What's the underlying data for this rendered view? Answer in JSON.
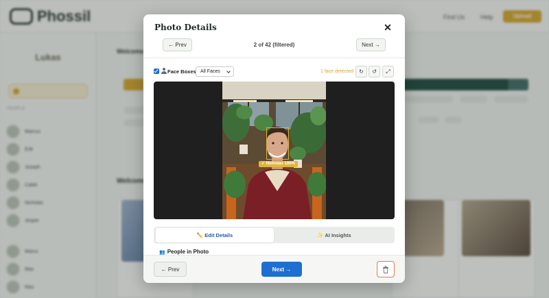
{
  "background": {
    "app_name": "Phossil",
    "top_links": [
      "Find Us",
      "Help"
    ],
    "upload_label": "Upload",
    "sidebar_user_name": "Lukas",
    "sidebar_section_label": "PEOPLE",
    "people": [
      {
        "name": "Marcus"
      },
      {
        "name": "Erik"
      },
      {
        "name": "Joseph"
      },
      {
        "name": "Caleb"
      },
      {
        "name": "Nicholas"
      },
      {
        "name": "Jesper"
      },
      {
        "name": "Marco"
      },
      {
        "name": "Max"
      },
      {
        "name": "Max"
      }
    ],
    "main_heading": "Welcome",
    "gallery_heading": "Welcome"
  },
  "modal": {
    "title": "Photo Details",
    "close_label": "✕",
    "prev_label": "← Prev",
    "next_label": "Next →",
    "counter": "2 of 42 (filtered)",
    "face_boxes_label": "Face Boxes",
    "face_filter_value": "All Faces",
    "detected_text": "1 face detected",
    "tools": {
      "rotate_right": "↻",
      "rotate_left": "↺",
      "expand": "⤢"
    },
    "face_tag": "✓ Nicholas 100%",
    "tabs": {
      "edit": "✏️ Edit Details",
      "insights": "✨ AI Insights"
    },
    "people_section": "People in Photo",
    "footer": {
      "prev": "← Prev",
      "next": "Next →"
    }
  },
  "colors": {
    "primary": "#1f6fd1",
    "accent": "#d4a52d",
    "danger": "#e07a56"
  },
  "icons": [
    "checkbox-icon",
    "person-icon",
    "chevron-down-icon",
    "rotate-right-icon",
    "rotate-left-icon",
    "expand-icon",
    "trash-icon",
    "close-icon",
    "people-icon"
  ]
}
